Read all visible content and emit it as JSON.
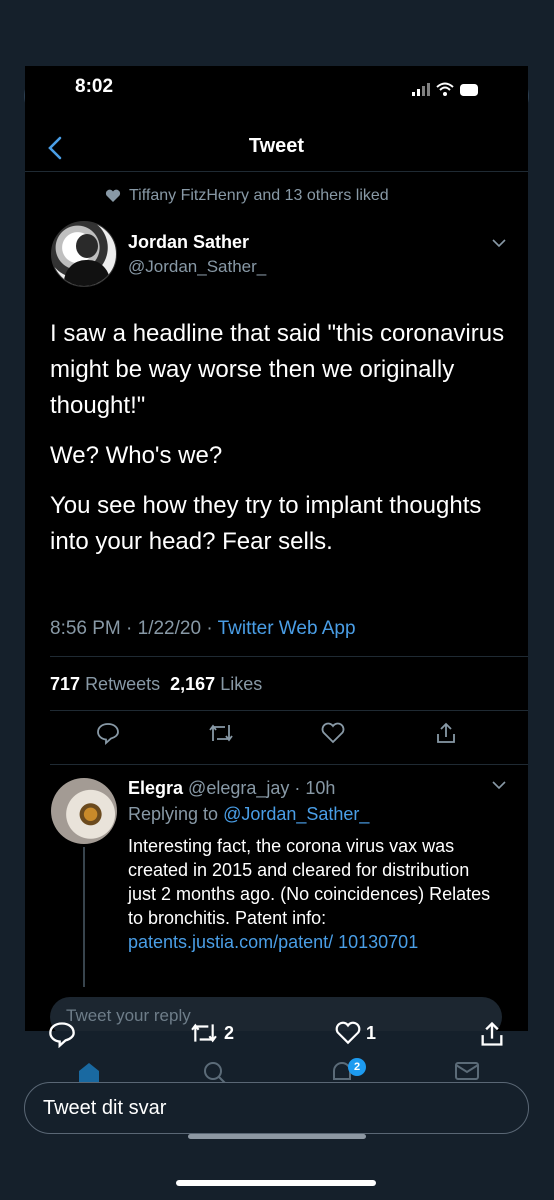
{
  "viewer": {
    "close_icon": "close-icon",
    "more_icon": "more-icon"
  },
  "status_bar": {
    "time": "8:02"
  },
  "nav": {
    "title": "Tweet",
    "back_icon": "chevron-left-icon"
  },
  "social_context": {
    "text": "Tiffany FitzHenry and 13 others liked"
  },
  "tweet": {
    "name": "Jordan Sather",
    "handle": "@Jordan_Sather_",
    "paragraphs": [
      "I saw a headline that said \"this coronavirus might be way worse then we originally thought!\"",
      "We? Who's we?",
      "You see how they try to implant thoughts into your head? Fear sells."
    ],
    "time": "8:56 PM · 1/22/20 · ",
    "source": "Twitter Web App",
    "retweets_count": "717",
    "retweets_label": "Retweets",
    "likes_count": "2,167",
    "likes_label": "Likes"
  },
  "reply": {
    "name": "Elegra",
    "handle_time": "@elegra_jay · 10h",
    "replying_prefix": "Replying to ",
    "replying_handle": "@Jordan_Sather_",
    "text": "Interesting fact, the corona virus vax was created in 2015 and cleared for distribution just 2 months ago.  (No coincidences)  Relates to bronchitis. Patent info: ",
    "link": "patents.justia.com/patent/ 10130701"
  },
  "reply_input": {
    "placeholder": "Tweet your reply"
  },
  "overlay_actions": {
    "retweets": "2",
    "likes": "1"
  },
  "tabbar": {
    "notifications_badge": "2"
  },
  "compose": {
    "placeholder": "Tweet dit svar"
  },
  "colors": {
    "accent": "#4a9ee6",
    "background": "#15202b",
    "muted": "#8899a6"
  }
}
